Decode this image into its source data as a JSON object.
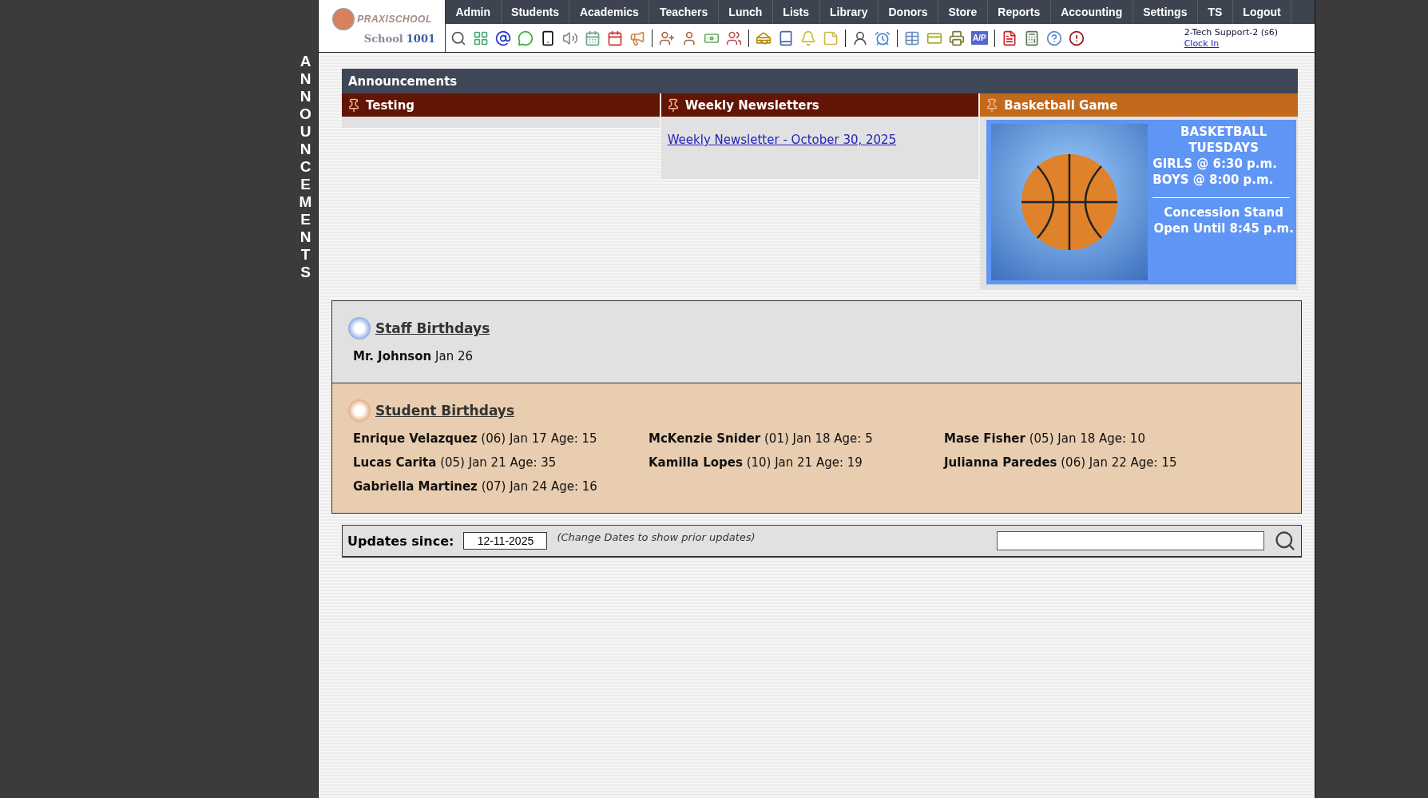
{
  "side_label": "ANNOUNCEMENTS",
  "logo": {
    "brand": "PRAXISCHOOL",
    "school_label": "School",
    "school_number": "1001"
  },
  "nav": [
    "Admin",
    "Students",
    "Academics",
    "Teachers",
    "Lunch",
    "Lists",
    "Library",
    "Donors",
    "Store",
    "Reports",
    "Accounting",
    "Settings",
    "TS",
    "Logout"
  ],
  "toolbar": {
    "ap_label": "A/P"
  },
  "user": {
    "name": "2-Tech Support-2 (s6)",
    "clock_link": "Clock In"
  },
  "announcements": {
    "title": "Announcements",
    "columns": [
      {
        "title": "Testing",
        "color": "#621405",
        "kind": "empty"
      },
      {
        "title": "Weekly Newsletters",
        "color": "#621405",
        "kind": "links",
        "links": [
          "Weekly Newsletter - October 30, 2025"
        ]
      },
      {
        "title": "Basketball Game",
        "color": "#c2691c",
        "kind": "poster",
        "lines": [
          {
            "text": "BASKETBALL TUESDAYS",
            "kind": "center"
          },
          {
            "text": "GIRLS @ 6:30 p.m.",
            "kind": "left"
          },
          {
            "text": "BOYS  @ 8:00 p.m.",
            "kind": "left"
          },
          {
            "kind": "rule"
          },
          {
            "text": "Concession Stand Open Until 8:45 p.m.",
            "kind": "center"
          }
        ]
      }
    ]
  },
  "staff_birthdays": {
    "title": "Staff Birthdays",
    "entries": [
      "**Mr. Johnson** Jan 26"
    ]
  },
  "student_birthdays": {
    "title": "Student Birthdays",
    "entries": [
      "**Enrique Velazquez** (06) Jan 17 Age: 15",
      "**McKenzie Snider** (01) Jan 18 Age: 5",
      "**Mase Fisher** (05) Jan 18 Age: 10",
      "**Lucas Carita** (05) Jan 21 Age: 35",
      "**Kamilla Lopes** (10) Jan 21 Age: 19",
      "**Julianna Paredes** (06) Jan 22 Age: 15",
      "**Gabriella Martinez** (07) Jan 24 Age: 16"
    ]
  },
  "updates": {
    "label": "Updates since:",
    "date": "12-11-2025",
    "hint": "(Change Dates to show prior updates)"
  }
}
